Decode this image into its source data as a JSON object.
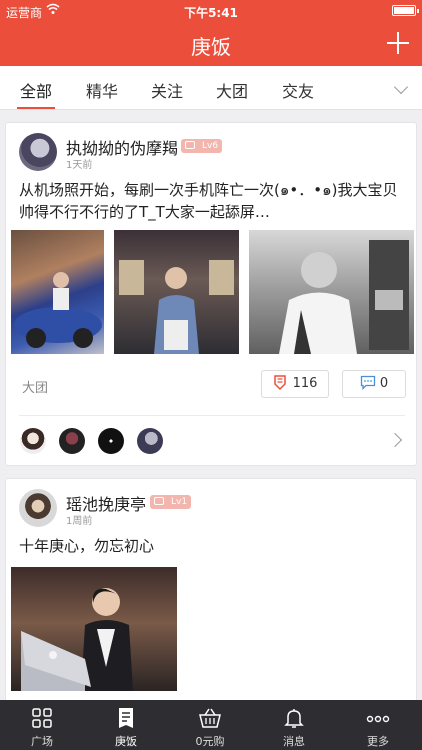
{
  "status_bar": {
    "carrier": "运营商",
    "time": "下午5:41"
  },
  "nav": {
    "title": "庚饭",
    "add_icon": "plus-icon"
  },
  "tabs": [
    "全部",
    "精华",
    "关注",
    "大团",
    "交友"
  ],
  "posts": [
    {
      "username": "执拗拗的伪摩羯",
      "level": "Lv6",
      "time": "1天前",
      "text_line1": "从机场照开始，每刷一次手机阵亡一次(๑•．•๑)我大宝贝",
      "text_line2": "帅得不行不行的了T_T大家一起舔屏…",
      "group": "大团",
      "likes": "116",
      "comments": "0"
    },
    {
      "username": "瑶池挽庚亭",
      "level": "Lv1",
      "time": "1周前",
      "text": "十年庚心，勿忘初心"
    }
  ],
  "tabbar": [
    "广场",
    "庚饭",
    "0元购",
    "消息",
    "更多"
  ],
  "colors": {
    "accent": "#eb4f3c",
    "tabbar_bg": "#2e2e32"
  }
}
